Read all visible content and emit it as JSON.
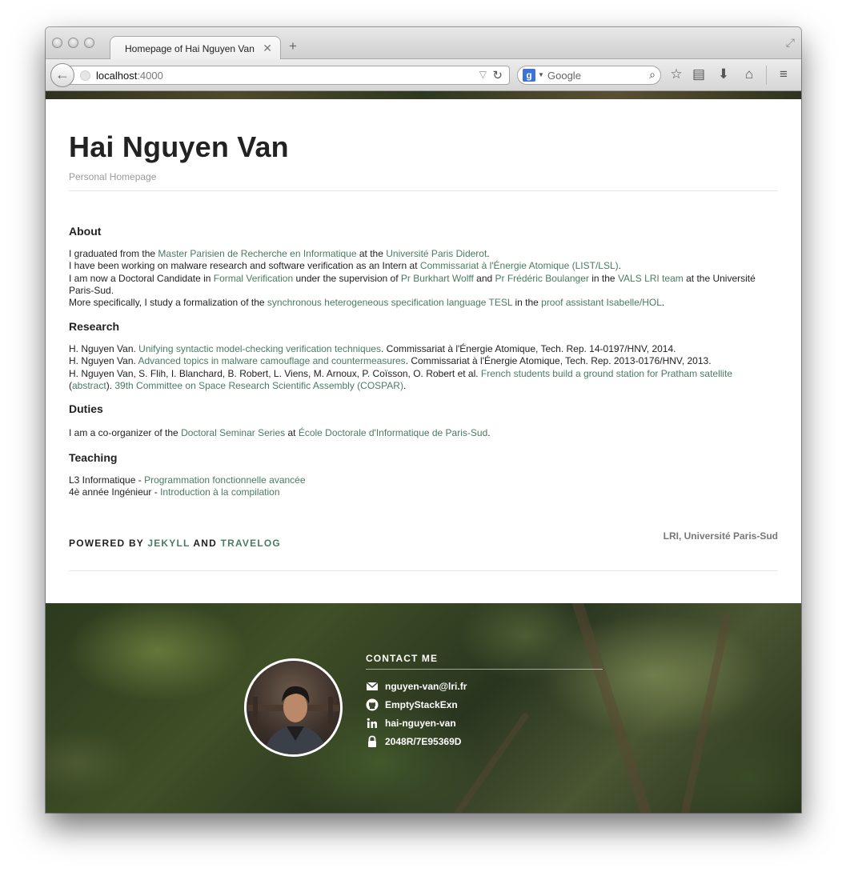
{
  "browser": {
    "tab_title": "Homepage of Hai Nguyen Van",
    "tab_close": "✕",
    "new_tab": "+",
    "url_host": "localhost",
    "url_port": ":4000",
    "search_engine_placeholder": "Google"
  },
  "site": {
    "title": "Hai Nguyen Van",
    "subtitle": "Personal Homepage"
  },
  "about": {
    "heading": "About",
    "l1": [
      "I graduated from the ",
      "Master Parisien de Recherche en Informatique",
      " at the ",
      "Université Paris Diderot",
      "."
    ],
    "l2": [
      "I have been working on malware research and software verification as an Intern at ",
      "Commissariat à l'Énergie Atomique (LIST/LSL)",
      "."
    ],
    "l3": [
      "I am now a Doctoral Candidate in ",
      "Formal Verification",
      " under the supervision of ",
      "Pr Burkhart Wolff",
      " and ",
      "Pr Frédéric Boulanger",
      " in the ",
      "VALS LRI team",
      " at the Université"
    ],
    "l3b": "Paris-Sud.",
    "l4": [
      "More specifically, I study a formalization of the ",
      "synchronous heterogeneous specification language TESL",
      " in the ",
      "proof assistant Isabelle/HOL",
      "."
    ]
  },
  "research": {
    "heading": "Research",
    "r1": [
      "H. Nguyen Van. ",
      "Unifying syntactic model-checking verification techniques",
      ". Commissariat à l'Énergie Atomique, Tech. Rep. 14-0197/HNV, 2014."
    ],
    "r2": [
      "H. Nguyen Van. ",
      "Advanced topics in malware camouflage and countermeasures",
      ". Commissariat à l'Énergie Atomique, Tech. Rep. 2013-0176/HNV, 2013."
    ],
    "r3": [
      "H. Nguyen Van, S. Flih, I. Blanchard, B. Robert, L. Viens, M. Arnoux, P. Coïsson, O. Robert et al. ",
      "French students build a ground station for Pratham satellite"
    ],
    "r3b": [
      "(",
      "abstract",
      "). ",
      "39th Committee on Space Research Scientific Assembly (COSPAR)",
      "."
    ]
  },
  "duties": {
    "heading": "Duties",
    "d1": [
      "I am a co-organizer of the ",
      "Doctoral Seminar Series",
      " at ",
      "École Doctorale d'Informatique de Paris-Sud",
      "."
    ]
  },
  "teaching": {
    "heading": "Teaching",
    "t1": [
      "L3 Informatique - ",
      "Programmation fonctionnelle avancée"
    ],
    "t2": [
      "4è année Ingénieur - ",
      "Introduction à la compilation"
    ]
  },
  "footer": {
    "powered_prefix": "POWERED BY ",
    "jekyll": "JEKYLL",
    "and": " AND ",
    "travelog": "TRAVELOG",
    "affiliation": "LRI, Université Paris-Sud"
  },
  "contact": {
    "heading": "CONTACT ME",
    "items": [
      {
        "icon": "mail-icon",
        "text": "nguyen-van@lri.fr"
      },
      {
        "icon": "github-icon",
        "text": "EmptyStackExn"
      },
      {
        "icon": "linkedin-icon",
        "text": "hai-nguyen-van"
      },
      {
        "icon": "lock-icon",
        "text": "2048R/7E95369D"
      }
    ]
  },
  "colors": {
    "link": "#4a7b64",
    "text": "#222222",
    "muted": "#999999"
  }
}
